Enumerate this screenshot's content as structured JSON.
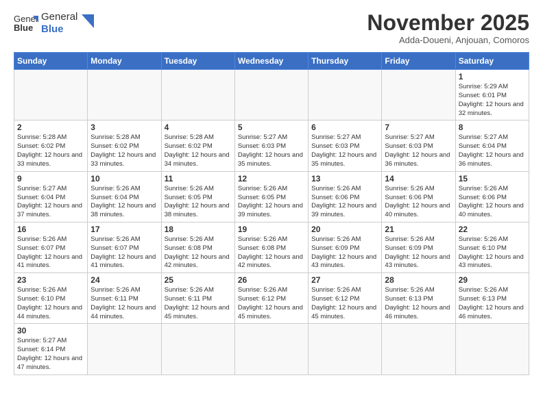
{
  "logo": {
    "line1": "General",
    "line2": "Blue"
  },
  "title": "November 2025",
  "subtitle": "Adda-Doueni, Anjouan, Comoros",
  "weekdays": [
    "Sunday",
    "Monday",
    "Tuesday",
    "Wednesday",
    "Thursday",
    "Friday",
    "Saturday"
  ],
  "weeks": [
    [
      {
        "day": "",
        "info": ""
      },
      {
        "day": "",
        "info": ""
      },
      {
        "day": "",
        "info": ""
      },
      {
        "day": "",
        "info": ""
      },
      {
        "day": "",
        "info": ""
      },
      {
        "day": "",
        "info": ""
      },
      {
        "day": "1",
        "info": "Sunrise: 5:29 AM\nSunset: 6:01 PM\nDaylight: 12 hours and 32 minutes."
      }
    ],
    [
      {
        "day": "2",
        "info": "Sunrise: 5:28 AM\nSunset: 6:02 PM\nDaylight: 12 hours and 33 minutes."
      },
      {
        "day": "3",
        "info": "Sunrise: 5:28 AM\nSunset: 6:02 PM\nDaylight: 12 hours and 33 minutes."
      },
      {
        "day": "4",
        "info": "Sunrise: 5:28 AM\nSunset: 6:02 PM\nDaylight: 12 hours and 34 minutes."
      },
      {
        "day": "5",
        "info": "Sunrise: 5:27 AM\nSunset: 6:03 PM\nDaylight: 12 hours and 35 minutes."
      },
      {
        "day": "6",
        "info": "Sunrise: 5:27 AM\nSunset: 6:03 PM\nDaylight: 12 hours and 35 minutes."
      },
      {
        "day": "7",
        "info": "Sunrise: 5:27 AM\nSunset: 6:03 PM\nDaylight: 12 hours and 36 minutes."
      },
      {
        "day": "8",
        "info": "Sunrise: 5:27 AM\nSunset: 6:04 PM\nDaylight: 12 hours and 36 minutes."
      }
    ],
    [
      {
        "day": "9",
        "info": "Sunrise: 5:27 AM\nSunset: 6:04 PM\nDaylight: 12 hours and 37 minutes."
      },
      {
        "day": "10",
        "info": "Sunrise: 5:26 AM\nSunset: 6:04 PM\nDaylight: 12 hours and 38 minutes."
      },
      {
        "day": "11",
        "info": "Sunrise: 5:26 AM\nSunset: 6:05 PM\nDaylight: 12 hours and 38 minutes."
      },
      {
        "day": "12",
        "info": "Sunrise: 5:26 AM\nSunset: 6:05 PM\nDaylight: 12 hours and 39 minutes."
      },
      {
        "day": "13",
        "info": "Sunrise: 5:26 AM\nSunset: 6:06 PM\nDaylight: 12 hours and 39 minutes."
      },
      {
        "day": "14",
        "info": "Sunrise: 5:26 AM\nSunset: 6:06 PM\nDaylight: 12 hours and 40 minutes."
      },
      {
        "day": "15",
        "info": "Sunrise: 5:26 AM\nSunset: 6:06 PM\nDaylight: 12 hours and 40 minutes."
      }
    ],
    [
      {
        "day": "16",
        "info": "Sunrise: 5:26 AM\nSunset: 6:07 PM\nDaylight: 12 hours and 41 minutes."
      },
      {
        "day": "17",
        "info": "Sunrise: 5:26 AM\nSunset: 6:07 PM\nDaylight: 12 hours and 41 minutes."
      },
      {
        "day": "18",
        "info": "Sunrise: 5:26 AM\nSunset: 6:08 PM\nDaylight: 12 hours and 42 minutes."
      },
      {
        "day": "19",
        "info": "Sunrise: 5:26 AM\nSunset: 6:08 PM\nDaylight: 12 hours and 42 minutes."
      },
      {
        "day": "20",
        "info": "Sunrise: 5:26 AM\nSunset: 6:09 PM\nDaylight: 12 hours and 43 minutes."
      },
      {
        "day": "21",
        "info": "Sunrise: 5:26 AM\nSunset: 6:09 PM\nDaylight: 12 hours and 43 minutes."
      },
      {
        "day": "22",
        "info": "Sunrise: 5:26 AM\nSunset: 6:10 PM\nDaylight: 12 hours and 43 minutes."
      }
    ],
    [
      {
        "day": "23",
        "info": "Sunrise: 5:26 AM\nSunset: 6:10 PM\nDaylight: 12 hours and 44 minutes."
      },
      {
        "day": "24",
        "info": "Sunrise: 5:26 AM\nSunset: 6:11 PM\nDaylight: 12 hours and 44 minutes."
      },
      {
        "day": "25",
        "info": "Sunrise: 5:26 AM\nSunset: 6:11 PM\nDaylight: 12 hours and 45 minutes."
      },
      {
        "day": "26",
        "info": "Sunrise: 5:26 AM\nSunset: 6:12 PM\nDaylight: 12 hours and 45 minutes."
      },
      {
        "day": "27",
        "info": "Sunrise: 5:26 AM\nSunset: 6:12 PM\nDaylight: 12 hours and 45 minutes."
      },
      {
        "day": "28",
        "info": "Sunrise: 5:26 AM\nSunset: 6:13 PM\nDaylight: 12 hours and 46 minutes."
      },
      {
        "day": "29",
        "info": "Sunrise: 5:26 AM\nSunset: 6:13 PM\nDaylight: 12 hours and 46 minutes."
      }
    ],
    [
      {
        "day": "30",
        "info": "Sunrise: 5:27 AM\nSunset: 6:14 PM\nDaylight: 12 hours and 47 minutes."
      },
      {
        "day": "",
        "info": ""
      },
      {
        "day": "",
        "info": ""
      },
      {
        "day": "",
        "info": ""
      },
      {
        "day": "",
        "info": ""
      },
      {
        "day": "",
        "info": ""
      },
      {
        "day": "",
        "info": ""
      }
    ]
  ]
}
